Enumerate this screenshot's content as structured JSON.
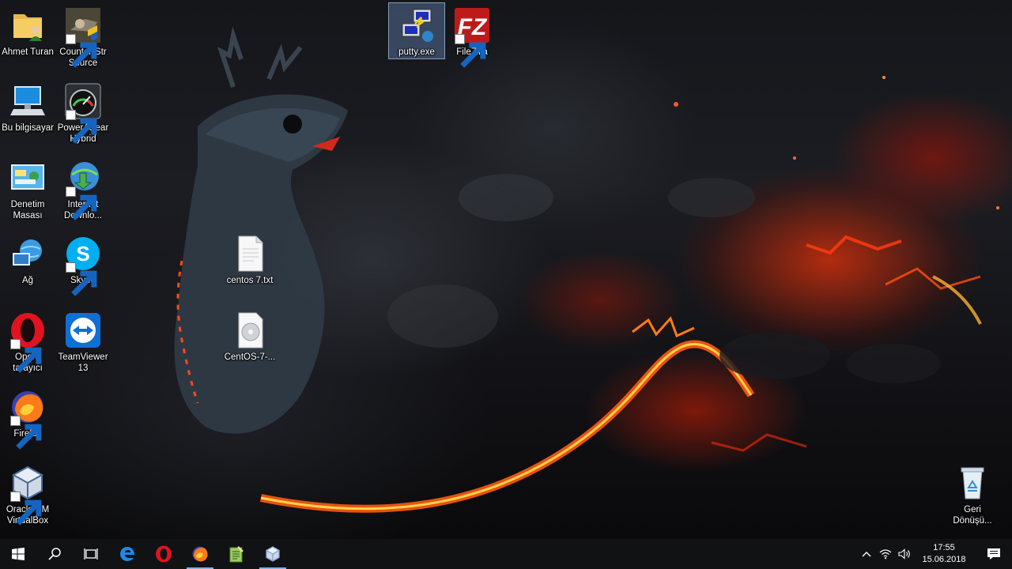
{
  "desktop": {
    "icons": [
      {
        "id": "ahmet",
        "label": "Ahmet Turan"
      },
      {
        "id": "counter",
        "label": "Counter-Str Source"
      },
      {
        "id": "pc",
        "label": "Bu bilgisayar"
      },
      {
        "id": "power4gear",
        "label": "Power4Gear Hybrid"
      },
      {
        "id": "control",
        "label": "Denetim Masası"
      },
      {
        "id": "idm",
        "label": "Internet Downlo..."
      },
      {
        "id": "network",
        "label": "Ağ"
      },
      {
        "id": "skype",
        "label": "Skype"
      },
      {
        "id": "opera",
        "label": "Opera tarayıcı"
      },
      {
        "id": "teamviewer",
        "label": "TeamViewer 13"
      },
      {
        "id": "firefox",
        "label": "Firefox"
      },
      {
        "id": "virtualbox",
        "label": "Oracle VM VirtualBox"
      },
      {
        "id": "putty",
        "label": "putty.exe"
      },
      {
        "id": "filezilla",
        "label": "FileZilla"
      },
      {
        "id": "centostxt",
        "label": "centos 7.txt"
      },
      {
        "id": "centosiso",
        "label": "CentOS-7-..."
      },
      {
        "id": "recycle",
        "label": "Geri Dönüşü..."
      }
    ],
    "selected_icon": "putty.exe"
  },
  "taskbar": {
    "buttons": [
      "start-icon",
      "search-icon",
      "task-view-icon",
      "edge-icon",
      "opera-icon",
      "firefox-icon",
      "notepad-icon",
      "virtualbox-icon"
    ],
    "clock": {
      "time": "17:55",
      "date": "15.06.2018"
    },
    "accent": "#7fb2ea"
  }
}
